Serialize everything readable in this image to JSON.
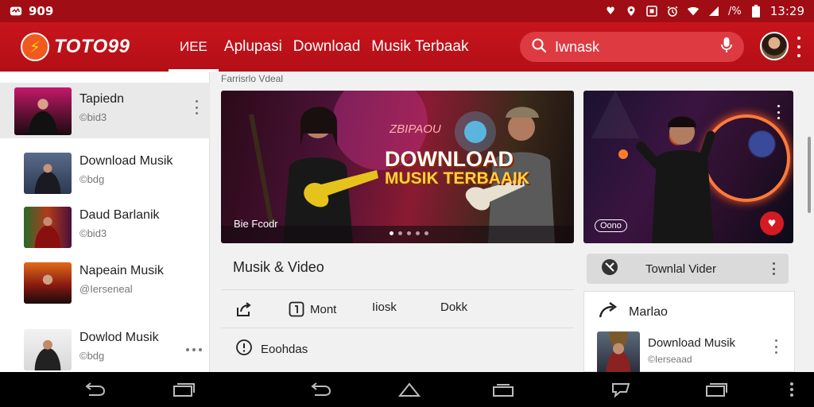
{
  "status_bar": {
    "app_badge": "909",
    "time": "13:29",
    "battery_text": "/%",
    "icons": [
      "notification-icon",
      "heart-icon",
      "location-icon",
      "nfc-icon",
      "alarm-icon",
      "wifi-icon",
      "signal-icon",
      "battery-icon"
    ]
  },
  "header": {
    "brand": "TOTO99",
    "tabs": [
      {
        "label": "ИEE",
        "active": true
      },
      {
        "label": "Aplupasi",
        "active": false
      },
      {
        "label": "Download",
        "active": false
      },
      {
        "label": "Musik Terbaak",
        "active": false
      }
    ],
    "search": {
      "value": "Iwnask"
    },
    "accent_color": "#c8141c"
  },
  "sidebar": {
    "items": [
      {
        "title": "Tapiedn",
        "subtitle": "©bid3",
        "active": true
      },
      {
        "title": "Download Musik",
        "subtitle": "©bdg"
      },
      {
        "title": "Daud Barlanik",
        "subtitle": "©bid3"
      },
      {
        "title": "Napeain Musik",
        "subtitle": "@Ierseneal"
      },
      {
        "title": "Dowlod Musik",
        "subtitle": "©bdg"
      }
    ]
  },
  "main": {
    "breadcrumb": "Farrisrlo Vdeal",
    "hero": {
      "kicker": "ZBIPAOU",
      "title_line1": "DOWNLOAD",
      "title_line2": "MUSIK TERBAAIK",
      "caption": "Bie Fcodr"
    },
    "side_card": {
      "chip": "Oono"
    },
    "section_title": "Musik & Video",
    "actions": [
      {
        "label": "",
        "icon": "share-icon"
      },
      {
        "label": "Mont",
        "icon": "info-box-icon"
      },
      {
        "label": "Iiosk",
        "icon": ""
      },
      {
        "label": "Dokk",
        "icon": ""
      }
    ],
    "row2_label": "Eoohdas",
    "right_pill": "Townlal Vider",
    "panel": {
      "head": "Marlao",
      "item_title": "Download Musik",
      "item_subtitle": "©Ierseaad"
    }
  }
}
